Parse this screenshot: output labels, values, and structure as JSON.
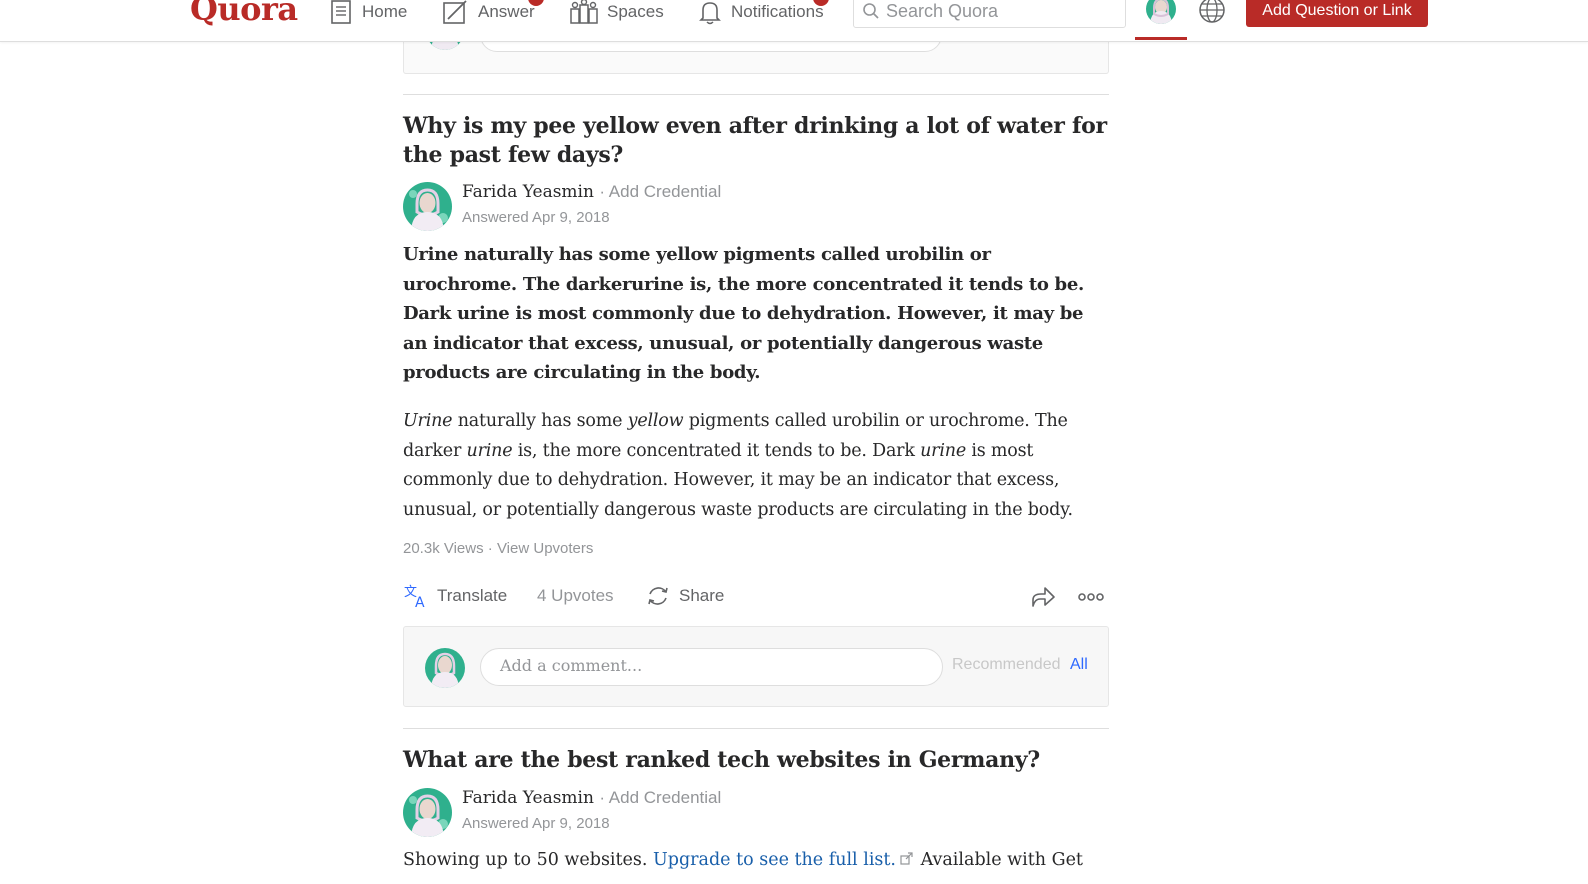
{
  "nav": {
    "logo": "Quora",
    "home": "Home",
    "answer": "Answer",
    "spaces": "Spaces",
    "notifications": "Notifications",
    "search_placeholder": "Search Quora",
    "add_question": "Add Question or Link"
  },
  "post1": {
    "question": "Why is my pee yellow even after drinking a lot of water for the past few days?",
    "author_name": "Farida Yeasmin",
    "author_credential": "· Add Credential",
    "date": "Answered Apr 9, 2018",
    "bold_summary": "Urine naturally has some yellow pigments called urobilin or urochrome. The darkerurine is, the more concentrated it tends to be. Dark urine is most commonly due to dehydration. However, it may be an indicator that excess, unusual, or potentially dangerous waste products are circulating in the body.",
    "body": {
      "w1": "Urine",
      "t1": " naturally has some ",
      "w2": "yellow",
      "t2": " pigments called urobilin or urochrome. The darker ",
      "w3": "urine",
      "t3": " is, the more concentrated it tends to be. Dark ",
      "w4": "urine",
      "t4": " is most commonly due to dehydration. However, it may be an indicator that excess, unusual, or potentially dangerous waste products are circulating in the body."
    },
    "views": "20.3k Views",
    "view_upvoters": "View Upvoters",
    "translate": "Translate",
    "upvotes": "4 Upvotes",
    "share": "Share",
    "comment_placeholder": "Add a comment...",
    "recommended": "Recommended",
    "all": "All"
  },
  "post2": {
    "question": "What are the best ranked tech websites in Germany?",
    "author_name": "Farida Yeasmin",
    "author_credential": "· Add Credential",
    "date": "Answered Apr 9, 2018",
    "text_before": "Showing up to 50 websites. ",
    "link": "Upgrade to see the full list.",
    "text_after": " Available with Get"
  },
  "colors": {
    "brand": "#b92b27",
    "link": "#195faa",
    "accent_blue": "#2e69ff"
  }
}
